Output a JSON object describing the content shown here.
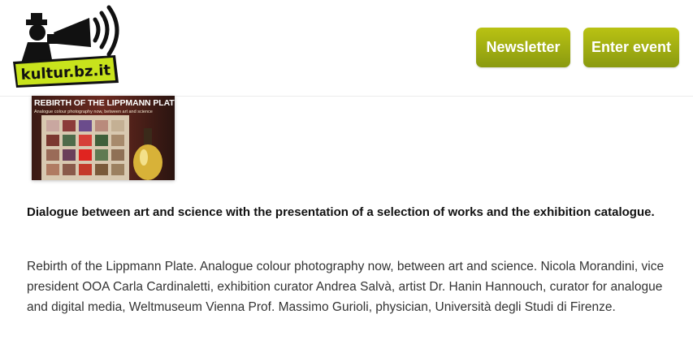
{
  "header": {
    "logo_text": "kultur.bz.it",
    "newsletter_label": "Newsletter",
    "enter_event_label": "Enter event"
  },
  "image": {
    "title": "REBIRTH OF THE LIPPMANN PLATE",
    "subtitle": "Analogue colour photography now, between art and science"
  },
  "content": {
    "lead": "Dialogue between art and science with the presentation of a selection of works and the exhibition catalogue.",
    "body": "Rebirth of the Lippmann Plate. Analogue colour photography now, between art and science. Nicola Morandini, vice president OOA Carla Cardinaletti, exhibition curator Andrea Salvà, artist Dr. Hanin Hannouch, curator for analogue and digital media, Weltmuseum Vienna Prof. Massimo Gurioli, physician, Università degli Studi di Firenze."
  },
  "colors": {
    "accent": "#a3b012",
    "logo_green": "#c8e31c",
    "logo_black": "#111111"
  }
}
